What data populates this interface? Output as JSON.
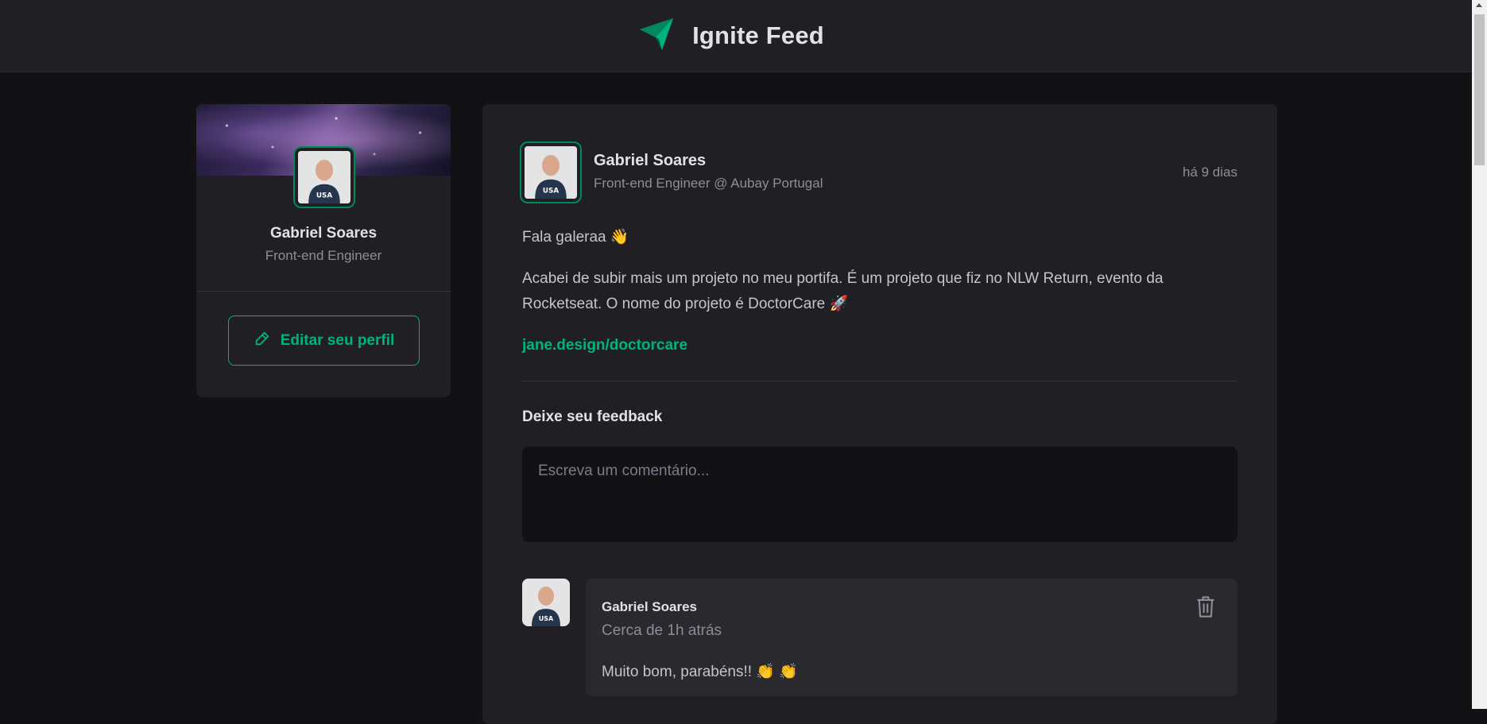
{
  "header": {
    "app_title": "Ignite Feed",
    "logo_icon": "ignite-logo-icon"
  },
  "sidebar": {
    "name": "Gabriel Soares",
    "role": "Front-end Engineer",
    "edit_button": "Editar seu perfil",
    "edit_icon": "pencil-icon"
  },
  "post": {
    "author": {
      "name": "Gabriel Soares",
      "role": "Front-end Engineer @ Aubay Portugal"
    },
    "time": "há 9 dias",
    "paragraphs": [
      "Fala galeraa 👋",
      "Acabei de subir mais um projeto no meu portifa. É um projeto que fiz no NLW Return, evento da Rocketseat. O nome do projeto é DoctorCare 🚀"
    ],
    "link": "jane.design/doctorcare",
    "feedback_title": "Deixe seu feedback",
    "comment_placeholder": "Escreva um comentário..."
  },
  "comments": [
    {
      "author": "Gabriel Soares",
      "time": "Cerca de 1h atrás",
      "text": "Muito bom, parabéns!! 👏 👏",
      "delete_icon": "trash-icon"
    }
  ],
  "colors": {
    "accent": "#00b37e",
    "accent_dark": "#00875f",
    "background": "#121214",
    "surface": "#202024"
  }
}
